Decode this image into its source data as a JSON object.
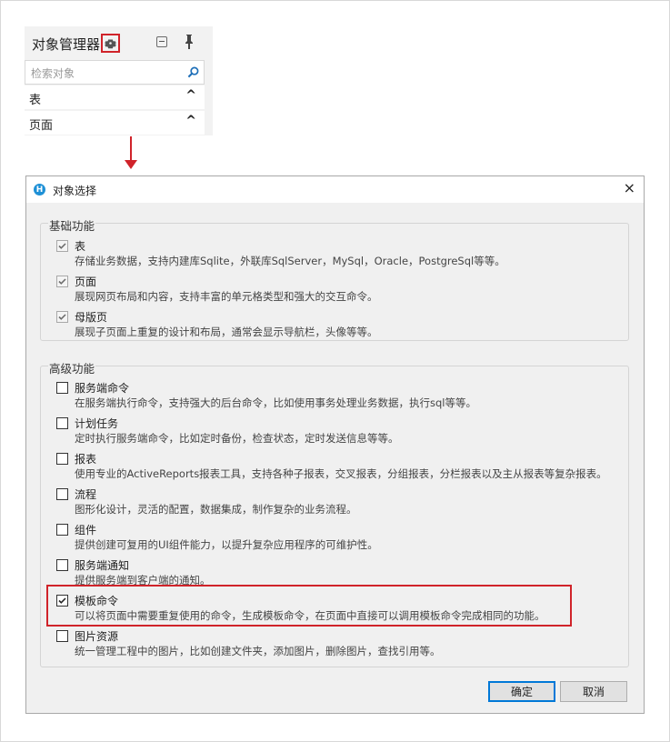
{
  "object_manager": {
    "title": "对象管理器",
    "search_placeholder": "检索对象",
    "rows": [
      {
        "label": "表",
        "chevron": "^"
      },
      {
        "label": "页面",
        "chevron": "^"
      }
    ]
  },
  "dialog": {
    "title": "对象选择",
    "app_icon": "H",
    "close": "×",
    "basic_group": {
      "label": "基础功能",
      "items": [
        {
          "name": "表",
          "desc": "存储业务数据，支持内建库Sqlite，外联库SqlServer，MySql，Oracle，PostgreSql等等。",
          "checked": true,
          "disabled": true
        },
        {
          "name": "页面",
          "desc": "展现网页布局和内容，支持丰富的单元格类型和强大的交互命令。",
          "checked": true,
          "disabled": true
        },
        {
          "name": "母版页",
          "desc": "展现子页面上重复的设计和布局，通常会显示导航栏，头像等等。",
          "checked": true,
          "disabled": true
        }
      ]
    },
    "advanced_group": {
      "label": "高级功能",
      "items": [
        {
          "name": "服务端命令",
          "desc": "在服务端执行命令，支持强大的后台命令，比如使用事务处理业务数据，执行sql等等。",
          "checked": false
        },
        {
          "name": "计划任务",
          "desc": "定时执行服务端命令，比如定时备份，检查状态，定时发送信息等等。",
          "checked": false
        },
        {
          "name": "报表",
          "desc": "使用专业的ActiveReports报表工具，支持各种子报表，交叉报表，分组报表，分栏报表以及主从报表等复杂报表。",
          "checked": false
        },
        {
          "name": "流程",
          "desc": "图形化设计，灵活的配置，数据集成，制作复杂的业务流程。",
          "checked": false
        },
        {
          "name": "组件",
          "desc": "提供创建可复用的UI组件能力，以提升复杂应用程序的可维护性。",
          "checked": false
        },
        {
          "name": "服务端通知",
          "desc": "提供服务端到客户端的通知。",
          "checked": false
        },
        {
          "name": "模板命令",
          "desc": "可以将页面中需要重复使用的命令，生成模板命令，在页面中直接可以调用模板命令完成相同的功能。",
          "checked": true
        },
        {
          "name": "图片资源",
          "desc": "统一管理工程中的图片，比如创建文件夹，添加图片，删除图片，查找引用等。",
          "checked": false
        }
      ]
    },
    "buttons": {
      "ok": "确定",
      "cancel": "取消"
    }
  },
  "colors": {
    "highlight": "#d0232a",
    "accent": "#0078d7",
    "app_icon": "#1e90d6"
  }
}
